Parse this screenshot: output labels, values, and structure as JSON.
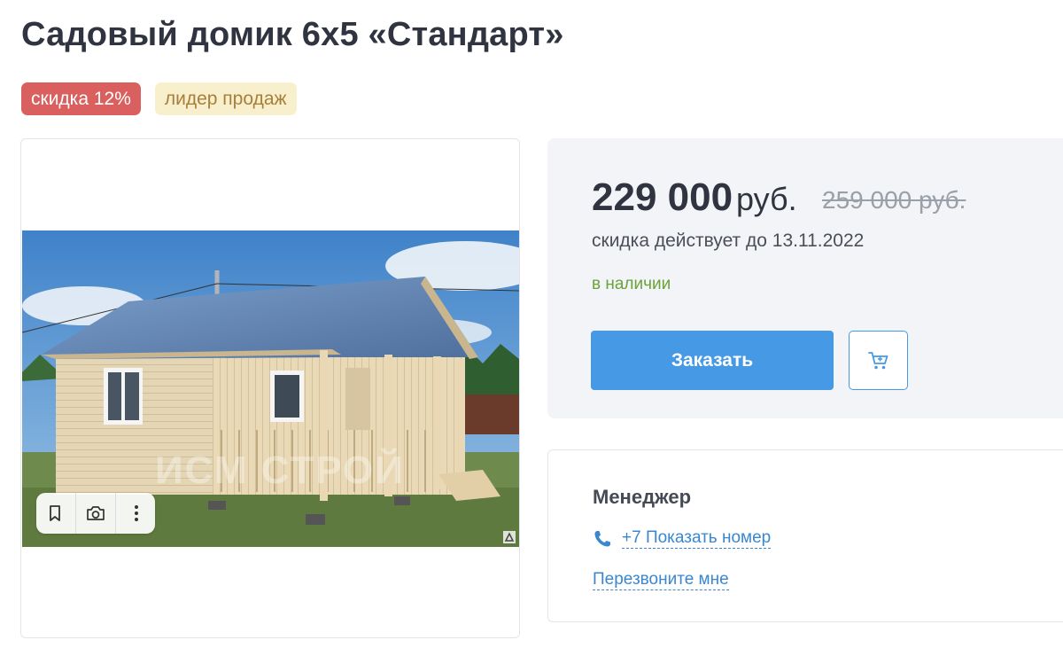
{
  "product": {
    "title": "Садовый домик 6х5 «Стандарт»",
    "badges": {
      "discount": "скидка 12%",
      "leader": "лидер продаж"
    }
  },
  "gallery": {
    "image_alt": "Садовый домик 6х5 «Стандарт»",
    "watermark": "ИСМ СТРОЙ",
    "tools": {
      "bookmark_icon": "bookmark-icon",
      "camera_icon": "camera-icon",
      "more_icon": "more-vertical-icon"
    }
  },
  "pricing": {
    "price": "229 000",
    "currency": "руб.",
    "old_price": "259 000 руб.",
    "discount_until": "скидка действует до 13.11.2022",
    "stock": "в наличии",
    "order_label": "Заказать",
    "cart_icon": "cart-icon"
  },
  "manager": {
    "title": "Менеджер",
    "phone_label": "+7 Показать номер",
    "callback_label": "Перезвоните мне",
    "phone_icon": "phone-icon"
  },
  "colors": {
    "discount_badge": "#d9605e",
    "leader_badge_bg": "#f8efcd",
    "leader_badge_text": "#a87f3a",
    "accent": "#4599e5",
    "stock": "#6aa339",
    "link": "#3a87d0"
  }
}
